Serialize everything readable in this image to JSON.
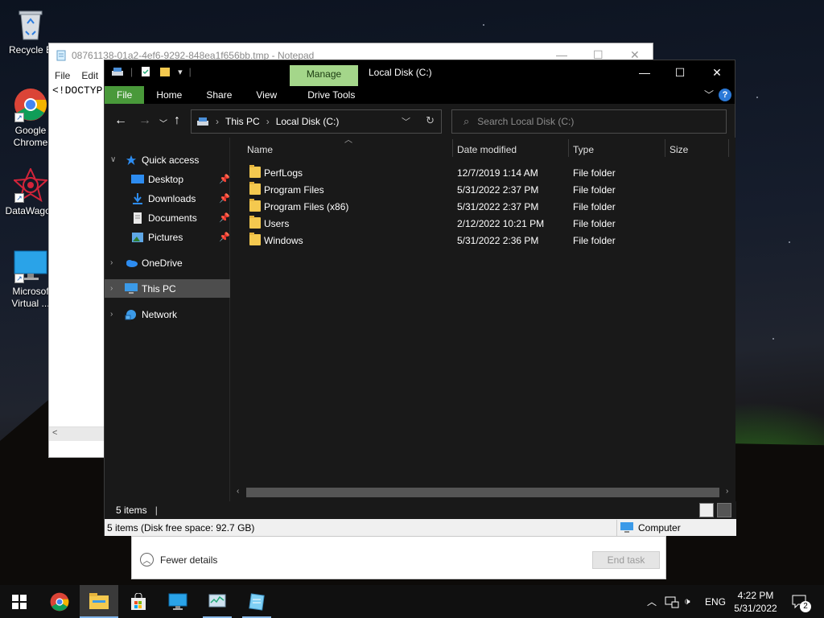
{
  "desktop": {
    "icons": [
      {
        "label": "Recycle B"
      },
      {
        "label": "Google Chrome"
      },
      {
        "label": "DataWagon"
      },
      {
        "label": "Microsof Virtual ..."
      }
    ]
  },
  "notepad": {
    "title": "08761138-01a2-4ef6-9292-848ea1f656bb.tmp - Notepad",
    "menu": [
      "File",
      "Edit"
    ],
    "content": "<!DOCTYP"
  },
  "task_manager": {
    "fewer_details": "Fewer details",
    "end_task": "End task"
  },
  "explorer": {
    "title": "Local Disk (C:)",
    "manage_tab": "Manage",
    "ribbon_tabs": [
      "File",
      "Home",
      "Share",
      "View",
      "Drive Tools"
    ],
    "address": {
      "root": "This PC",
      "current": "Local Disk (C:)"
    },
    "search_placeholder": "Search Local Disk (C:)",
    "columns": {
      "name": "Name",
      "date": "Date modified",
      "type": "Type",
      "size": "Size"
    },
    "files": [
      {
        "name": "PerfLogs",
        "date": "12/7/2019 1:14 AM",
        "type": "File folder"
      },
      {
        "name": "Program Files",
        "date": "5/31/2022 2:37 PM",
        "type": "File folder"
      },
      {
        "name": "Program Files (x86)",
        "date": "5/31/2022 2:37 PM",
        "type": "File folder"
      },
      {
        "name": "Users",
        "date": "2/12/2022 10:21 PM",
        "type": "File folder"
      },
      {
        "name": "Windows",
        "date": "5/31/2022 2:36 PM",
        "type": "File folder"
      }
    ],
    "sidebar": {
      "quick_access": "Quick access",
      "desktop": "Desktop",
      "downloads": "Downloads",
      "documents": "Documents",
      "pictures": "Pictures",
      "onedrive": "OneDrive",
      "this_pc": "This PC",
      "network": "Network"
    },
    "status_items": "5 items",
    "lower_status": "5 items (Disk free space: 92.7 GB)",
    "lower_status_right": "Computer"
  },
  "taskbar": {
    "language": "ENG",
    "time": "4:22 PM",
    "date": "5/31/2022",
    "notification_count": "2"
  },
  "colors": {
    "explorer_bg": "#191919",
    "manage_tab": "#a4d68a",
    "file_tab": "#49993a",
    "folder": "#f4c94f",
    "selected": "#4d4d4d"
  }
}
